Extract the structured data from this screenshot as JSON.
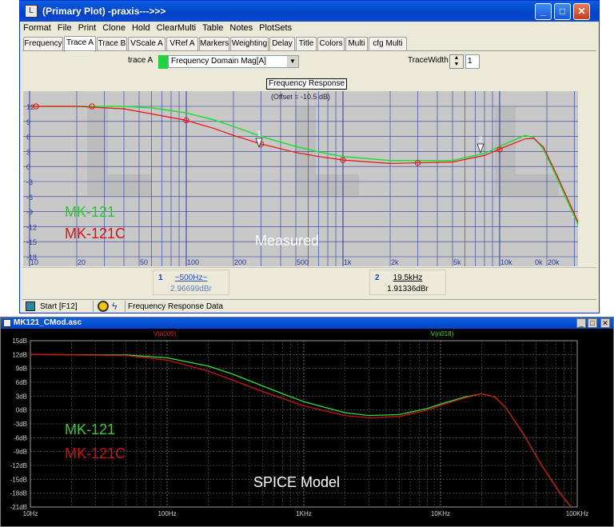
{
  "top_window": {
    "title": "(Primary Plot) -praxis--->>>",
    "menu": [
      "Format",
      "File",
      "Print",
      "Clone",
      "Hold",
      "ClearMulti",
      "Table",
      "Notes",
      "PlotSets"
    ],
    "tabs": [
      "Frequency",
      "Trace A",
      "Trace B",
      "VScale A",
      "VRef A",
      "Markers",
      "Weighting",
      "Delay",
      "Title",
      "Colors",
      "Multi",
      "cfg Multi"
    ],
    "active_tab": "Trace A",
    "trace_label": "trace A",
    "trace_select": "Frequency Domain Mag[A]",
    "trace_width_label": "TraceWidth",
    "trace_width_value": "1",
    "plot_label": "Frequency Response",
    "offset_text": "(Offset = -10.5 dB)",
    "y_ticks": [
      "12",
      "9",
      "6",
      "3",
      "0",
      "-3",
      "-6",
      "-9",
      "-12",
      "-15",
      "-18"
    ],
    "x_ticks": [
      "10",
      "20",
      "50",
      "100",
      "200",
      "500",
      "1k",
      "2k",
      "5k",
      "10k",
      "20k"
    ],
    "x_end_tick": "0k",
    "marker_labels": [
      "1",
      "2"
    ],
    "legend_mk121": "MK-121",
    "legend_mk121c": "MK-121C",
    "caption": "Measured",
    "marker1": {
      "num": "1",
      "freq": "~500Hz~",
      "value": "2.96699dBr"
    },
    "marker2": {
      "num": "2",
      "freq": "19.5kHz",
      "value": "1.91336dBr"
    },
    "status_start": "Start [F12]",
    "status_text": "Frequency Response Data",
    "colors": {
      "green": "#22dd33",
      "red": "#ee1111",
      "grid": "#2a3a9a"
    }
  },
  "bottom_window": {
    "title": "MK121_CMod.asc",
    "trace_label_red": "V(n005)",
    "trace_label_green": "V(n018)",
    "y_ticks": [
      "15dB",
      "12dB",
      "9dB",
      "6dB",
      "3dB",
      "0dB",
      "-3dB",
      "-6dB",
      "-9dB",
      "-12dB",
      "-15dB",
      "-18dB",
      "-21dB"
    ],
    "x_ticks": [
      "10Hz",
      "100Hz",
      "1KHz",
      "10KHz",
      "100KHz"
    ],
    "legend_mk121": "MK-121",
    "legend_mk121c": "MK-121C",
    "caption": "SPICE Model",
    "colors": {
      "green": "#33dd33",
      "red": "#cc1111",
      "grid": "#7a7a7a"
    }
  }
}
